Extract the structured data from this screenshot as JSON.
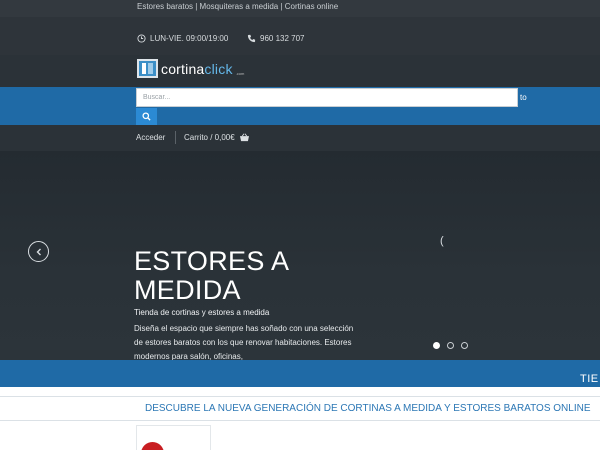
{
  "topbar": {
    "tagline": "Estores baratos | Mosquiteras a medida | Cortinas online"
  },
  "contact": {
    "hours": "LUN-VIE. 09:00/19:00",
    "hours_icon": "clock-icon",
    "phone": "960 132 707",
    "phone_icon": "phone-icon"
  },
  "logo": {
    "part1": "cortina",
    "part2": "click",
    "tld": ".com"
  },
  "search": {
    "placeholder": "Buscar...",
    "value": "",
    "button_icon": "search-icon",
    "nav_fragment": "to"
  },
  "account": {
    "login_label": "Acceder",
    "cart_label": "Carrito / 0,00€",
    "cart_icon": "basket-icon"
  },
  "hero": {
    "title_line1": "ESTORES A",
    "title_line2": "MEDIDA",
    "subtitle": "Tienda de cortinas y estores a medida",
    "body": "Diseña el espacio que siempre has soñado con una selección de estores baratos con los que renovar habitaciones. Estores modernos para salón, oficinas,",
    "loader_glyph": "(",
    "slide_active": 1,
    "slide_count": 3
  },
  "ticker": {
    "text": "TIE"
  },
  "promo": {
    "headline": "DESCUBRE LA NUEVA GENERACIÓN DE CORTINAS A MEDIDA Y ESTORES BARATOS ONLINE"
  },
  "colors": {
    "primary_blue": "#1f6aa6",
    "accent_blue": "#2b8ad4",
    "dark_bg": "#2b3238",
    "promo_text": "#2c77b5",
    "badge_red": "#c81e22"
  }
}
